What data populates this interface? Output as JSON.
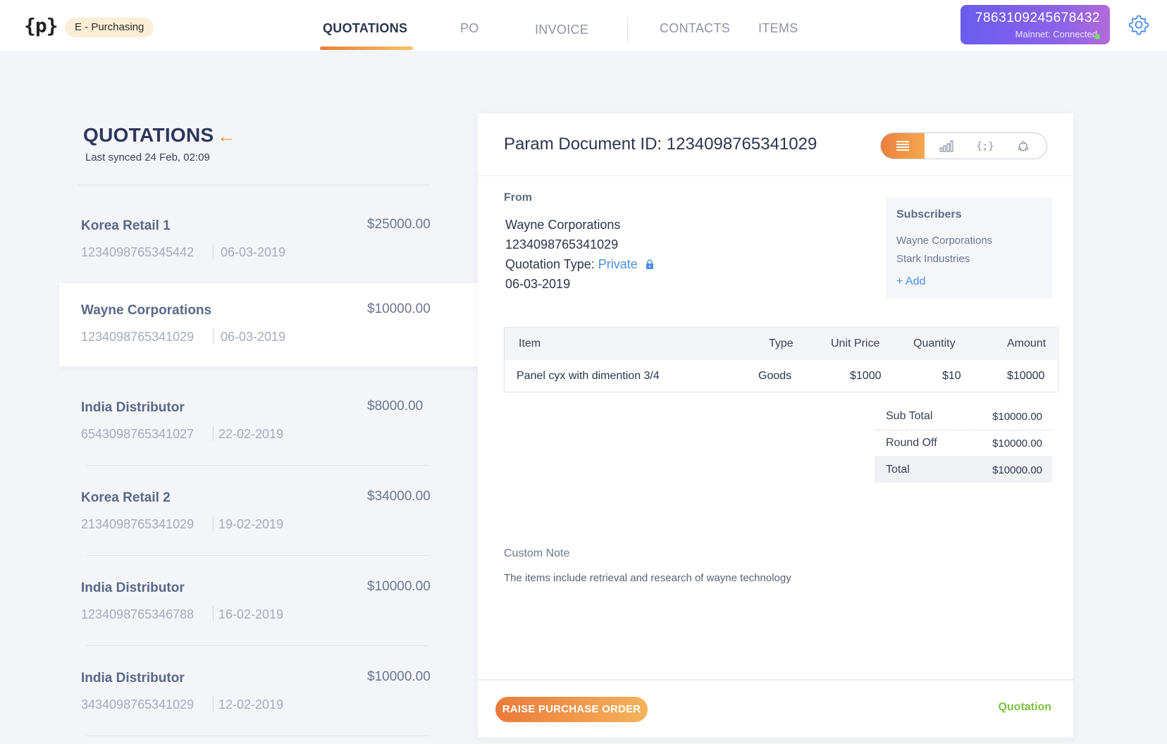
{
  "header": {
    "logo": "{p}",
    "app_name": "E - Purchasing",
    "tabs": [
      {
        "label": "QUOTATIONS",
        "active": true
      },
      {
        "label": "PO",
        "active": false
      },
      {
        "label": "INVOICE",
        "active": false
      },
      {
        "label": "CONTACTS",
        "active": false
      },
      {
        "label": "ITEMS",
        "active": false
      }
    ],
    "account": {
      "number": "7863109245678432",
      "status": "Mainnet: Connected"
    },
    "settings_icon": "gear-icon"
  },
  "list": {
    "title": "QUOTATIONS",
    "back_icon": "arrow-left-icon",
    "last_synced": "Last synced 24 Feb, 02:09",
    "items": [
      {
        "name": "Korea Retail 1",
        "amount": "$25000.00",
        "id": "1234098765345442",
        "date": "06-03-2019",
        "selected": false
      },
      {
        "name": "Wayne Corporations",
        "amount": "$10000.00",
        "id": "1234098765341029",
        "date": "06-03-2019",
        "selected": true
      },
      {
        "name": "India Distributor",
        "amount": "$8000.00",
        "id": "6543098765341027",
        "date": "22-02-2019",
        "selected": false
      },
      {
        "name": "Korea Retail 2",
        "amount": "$34000.00",
        "id": "2134098765341029",
        "date": "19-02-2019",
        "selected": false
      },
      {
        "name": "India Distributor",
        "amount": "$10000.00",
        "id": "1234098765346788",
        "date": "16-02-2019",
        "selected": false
      },
      {
        "name": "India Distributor",
        "amount": "$10000.00",
        "id": "3434098765341029",
        "date": "12-02-2019",
        "selected": false
      }
    ]
  },
  "document": {
    "title": "Param Document ID: 1234098765341029",
    "view_toggle": [
      "list-icon",
      "bar-chart-icon",
      "code-braces-icon",
      "network-icon"
    ],
    "from": {
      "label": "From",
      "company": "Wayne Corporations",
      "id": "1234098765341029",
      "type_label": "Quotation Type:",
      "type_value": "Private",
      "date": "06-03-2019"
    },
    "subscribers": {
      "title": "Subscribers",
      "items": [
        "Wayne Corporations",
        "Stark Industries"
      ],
      "add_label": "+ Add"
    },
    "table": {
      "headers": {
        "item": "Item",
        "type": "Type",
        "unit_price": "Unit Price",
        "quantity": "Quantity",
        "amount": "Amount"
      },
      "rows": [
        {
          "item": "Panel cyx with dimention 3/4",
          "type": "Goods",
          "unit_price": "$1000",
          "quantity": "$10",
          "amount": "$10000"
        }
      ]
    },
    "totals": {
      "sub_total_label": "Sub Total",
      "sub_total": "$10000.00",
      "round_off_label": "Round Off",
      "round_off": "$10000.00",
      "total_label": "Total",
      "total": "$10000.00"
    },
    "note": {
      "label": "Custom Note",
      "text": "The items include retrieval and research of wayne technology"
    },
    "footer": {
      "action_label": "RAISE PURCHASE ORDER",
      "doc_type": "Quotation"
    }
  },
  "colors": {
    "accent_orange": "#ec7f3c",
    "accent_purple": "#7a5fee",
    "link_blue": "#4a8ee8",
    "status_green": "#7dc242"
  }
}
